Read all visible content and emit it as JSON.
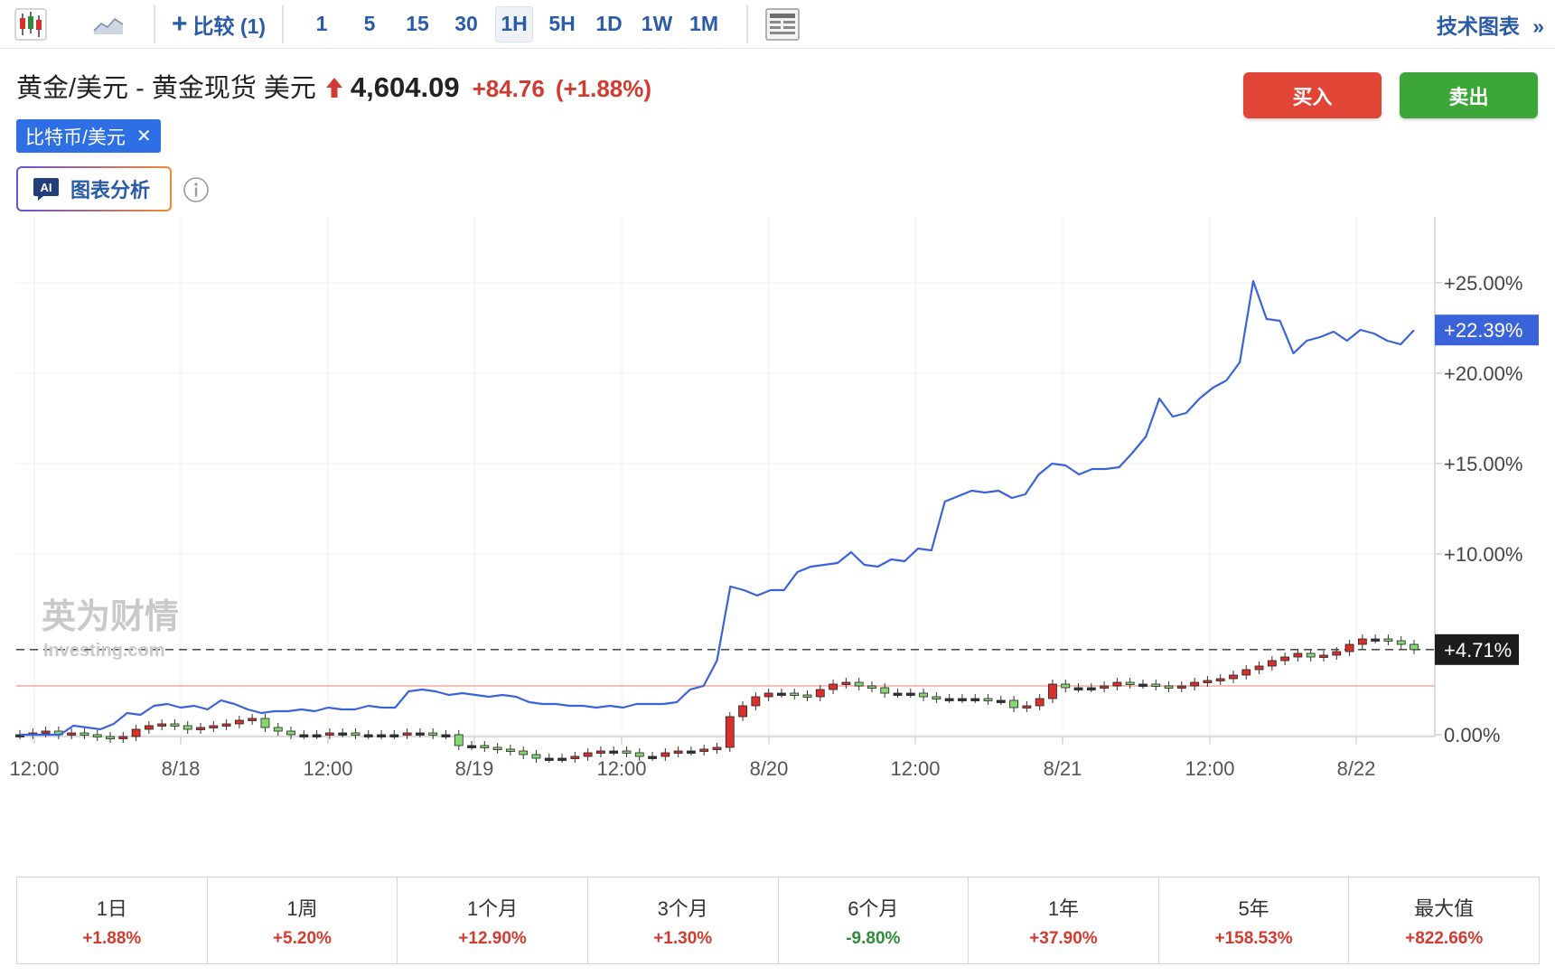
{
  "toolbar": {
    "compare_label": "比较 (1)",
    "intervals": [
      "1",
      "5",
      "15",
      "30",
      "1H",
      "5H",
      "1D",
      "1W",
      "1M"
    ],
    "active_interval": "1H",
    "tech_chart_label": "技术图表"
  },
  "header": {
    "title": "黄金/美元 - 黄金现货 美元",
    "price": "4,604.09",
    "change": "+84.76",
    "change_pct": "(+1.88%)",
    "buy_label": "买入",
    "sell_label": "卖出",
    "compare_chip": "比特币/美元",
    "ai_badge": "AI",
    "ai_label": "图表分析"
  },
  "colors": {
    "accent": "#2a5ba8",
    "compare_line": "#3b63d9",
    "up_candle": "#d8302a",
    "down_candle": "#86d873",
    "buy": "#e04536",
    "sell": "#3da638",
    "positive": "#d23b2f",
    "negative": "#2e8b3a"
  },
  "chart_data": {
    "type": "line",
    "x_axis": {
      "ticks": [
        "12:00",
        "8/18",
        "12:00",
        "8/19",
        "12:00",
        "8/20",
        "12:00",
        "8/21",
        "12:00",
        "8/22"
      ]
    },
    "y_axis": {
      "ticks": [
        "+25.00%",
        "+20.00%",
        "+15.00%",
        "+10.00%",
        "0.00%"
      ],
      "tick_values": [
        25,
        20,
        15,
        10,
        0
      ],
      "range": [
        -4,
        25
      ]
    },
    "watermark": {
      "main": "英为财情",
      "sub": "Investing.com"
    },
    "grid": true,
    "series": [
      {
        "name": "比特币/美元",
        "kind": "line",
        "last_label": "+22.39%",
        "values": [
          0,
          0,
          0,
          0,
          0.5,
          0.4,
          0.3,
          0.6,
          1.2,
          1.1,
          1.6,
          1.7,
          1.5,
          1.6,
          1.4,
          1.9,
          1.7,
          1.4,
          1.2,
          1.3,
          1.3,
          1.4,
          1.3,
          1.5,
          1.4,
          1.4,
          1.6,
          1.5,
          1.5,
          2.4,
          2.5,
          2.4,
          2.2,
          2.3,
          2.2,
          2.1,
          2.2,
          2.1,
          1.8,
          1.7,
          1.7,
          1.6,
          1.6,
          1.5,
          1.6,
          1.5,
          1.7,
          1.7,
          1.7,
          1.8,
          2.5,
          2.7,
          4.1,
          8.2,
          8.0,
          7.7,
          8.0,
          8.0,
          9.0,
          9.3,
          9.4,
          9.5,
          10.1,
          9.4,
          9.3,
          9.7,
          9.6,
          10.3,
          10.2,
          12.9,
          13.2,
          13.5,
          13.4,
          13.5,
          13.1,
          13.3,
          14.4,
          15.0,
          14.9,
          14.4,
          14.7,
          14.7,
          14.8,
          15.6,
          16.5,
          18.6,
          17.6,
          17.8,
          18.6,
          19.2,
          19.6,
          20.6,
          25.1,
          23.0,
          22.9,
          21.1,
          21.8,
          22.0,
          22.3,
          21.8,
          22.4,
          22.2,
          21.8,
          21.6,
          22.39
        ]
      },
      {
        "name": "黄金/美元 - 黄金现货",
        "kind": "candlestick",
        "last_label": "+4.71%",
        "closes": [
          0.0,
          0.1,
          0.2,
          0.0,
          0.1,
          0.0,
          -0.1,
          -0.2,
          -0.1,
          0.3,
          0.5,
          0.6,
          0.5,
          0.3,
          0.4,
          0.5,
          0.6,
          0.8,
          0.9,
          0.4,
          0.2,
          0.0,
          0.0,
          0.0,
          0.1,
          0.1,
          0.0,
          0.0,
          0.0,
          0.0,
          0.1,
          0.1,
          0.0,
          0.0,
          -0.6,
          -0.6,
          -0.7,
          -0.8,
          -0.9,
          -1.1,
          -1.3,
          -1.3,
          -1.3,
          -1.2,
          -1.0,
          -0.9,
          -0.9,
          -1.0,
          -1.2,
          -1.2,
          -1.0,
          -0.9,
          -0.9,
          -0.8,
          -0.7,
          1.0,
          1.6,
          2.1,
          2.3,
          2.3,
          2.2,
          2.1,
          2.5,
          2.8,
          2.9,
          2.7,
          2.6,
          2.3,
          2.3,
          2.3,
          2.1,
          2.0,
          2.0,
          2.0,
          2.0,
          1.9,
          1.9,
          1.5,
          1.6,
          2.0,
          2.8,
          2.6,
          2.6,
          2.6,
          2.7,
          2.9,
          2.8,
          2.8,
          2.7,
          2.6,
          2.7,
          2.9,
          3.0,
          3.1,
          3.3,
          3.6,
          3.8,
          4.1,
          4.3,
          4.5,
          4.3,
          4.4,
          4.6,
          5.0,
          5.3,
          5.3,
          5.2,
          5.0,
          4.71
        ],
        "opens": [
          0.0,
          0.0,
          0.1,
          0.2,
          0.0,
          0.1,
          0.0,
          -0.1,
          -0.2,
          -0.1,
          0.3,
          0.5,
          0.6,
          0.5,
          0.3,
          0.4,
          0.5,
          0.6,
          0.8,
          0.9,
          0.4,
          0.2,
          0.0,
          0.0,
          0.0,
          0.1,
          0.1,
          0.0,
          0.0,
          0.0,
          0.0,
          0.1,
          0.1,
          0.0,
          0.0,
          -0.6,
          -0.6,
          -0.7,
          -0.8,
          -0.9,
          -1.1,
          -1.3,
          -1.3,
          -1.3,
          -1.2,
          -1.0,
          -0.9,
          -0.9,
          -1.0,
          -1.2,
          -1.2,
          -1.0,
          -0.9,
          -0.9,
          -0.8,
          -0.7,
          1.0,
          1.6,
          2.1,
          2.3,
          2.3,
          2.2,
          2.1,
          2.5,
          2.8,
          2.9,
          2.7,
          2.6,
          2.3,
          2.3,
          2.3,
          2.1,
          2.0,
          2.0,
          2.0,
          2.0,
          1.9,
          1.9,
          1.5,
          1.6,
          2.0,
          2.8,
          2.6,
          2.6,
          2.6,
          2.7,
          2.9,
          2.8,
          2.8,
          2.7,
          2.6,
          2.7,
          2.9,
          3.0,
          3.1,
          3.3,
          3.6,
          3.8,
          4.1,
          4.3,
          4.5,
          4.3,
          4.4,
          4.6,
          5.0,
          5.3,
          5.3,
          5.2,
          5.0
        ]
      }
    ]
  },
  "periods": [
    {
      "label": "1日",
      "value": "+1.88%",
      "sign": "pos"
    },
    {
      "label": "1周",
      "value": "+5.20%",
      "sign": "pos"
    },
    {
      "label": "1个月",
      "value": "+12.90%",
      "sign": "pos"
    },
    {
      "label": "3个月",
      "value": "+1.30%",
      "sign": "pos"
    },
    {
      "label": "6个月",
      "value": "-9.80%",
      "sign": "neg"
    },
    {
      "label": "1年",
      "value": "+37.90%",
      "sign": "pos"
    },
    {
      "label": "5年",
      "value": "+158.53%",
      "sign": "pos"
    },
    {
      "label": "最大值",
      "value": "+822.66%",
      "sign": "pos"
    }
  ]
}
